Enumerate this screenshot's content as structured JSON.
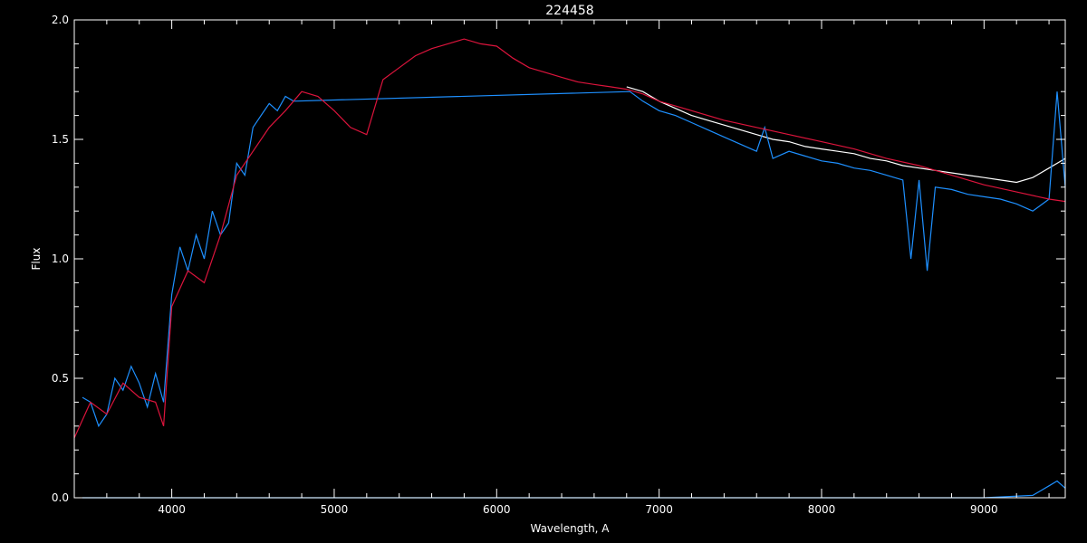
{
  "chart_data": {
    "type": "line",
    "title": "224458",
    "xlabel": "Wavelength, A",
    "ylabel": "Flux",
    "xlim": [
      3400,
      9500
    ],
    "ylim": [
      0.0,
      2.0
    ],
    "x_ticks": [
      4000,
      5000,
      6000,
      7000,
      8000,
      9000
    ],
    "x_tick_labels": [
      "4000",
      "5000",
      "6000",
      "7000",
      "8000",
      "9000"
    ],
    "y_ticks": [
      0.0,
      0.5,
      1.0,
      1.5,
      2.0
    ],
    "y_tick_labels": [
      "0.0",
      "0.5",
      "1.0",
      "1.5",
      "2.0"
    ],
    "background": "#000000",
    "grid": false,
    "series": [
      {
        "color": "#ffffff",
        "x": [
          6800,
          6900,
          7000,
          7100,
          7200,
          7300,
          7400,
          7500,
          7600,
          7700,
          7800,
          7900,
          8000,
          8100,
          8200,
          8300,
          8400,
          8500,
          8600,
          8700,
          8800,
          8900,
          9000,
          9100,
          9200,
          9300,
          9400,
          9500
        ],
        "y": [
          1.72,
          1.7,
          1.66,
          1.63,
          1.6,
          1.58,
          1.56,
          1.54,
          1.52,
          1.5,
          1.49,
          1.47,
          1.46,
          1.45,
          1.44,
          1.42,
          1.41,
          1.39,
          1.38,
          1.37,
          1.36,
          1.35,
          1.34,
          1.33,
          1.32,
          1.34,
          1.38,
          1.42
        ]
      },
      {
        "color": "#1e90ff",
        "x": [
          3450,
          3500,
          3550,
          3600,
          3650,
          3700,
          3750,
          3800,
          3850,
          3900,
          3950,
          4000,
          4050,
          4100,
          4150,
          4200,
          4250,
          4300,
          4350,
          4400,
          4450,
          4500,
          4550,
          4600,
          4650,
          4700,
          4750,
          6820,
          6900,
          7000,
          7100,
          7200,
          7300,
          7400,
          7500,
          7600,
          7650,
          7700,
          7800,
          7900,
          8000,
          8100,
          8200,
          8300,
          8400,
          8500,
          8550,
          8600,
          8650,
          8700,
          8800,
          8900,
          9000,
          9100,
          9200,
          9300,
          9400,
          9450,
          9500
        ],
        "y": [
          0.42,
          0.4,
          0.3,
          0.35,
          0.5,
          0.45,
          0.55,
          0.48,
          0.38,
          0.52,
          0.4,
          0.85,
          1.05,
          0.95,
          1.1,
          1.0,
          1.2,
          1.1,
          1.15,
          1.4,
          1.35,
          1.55,
          1.6,
          1.65,
          1.62,
          1.68,
          1.66,
          1.7,
          1.66,
          1.62,
          1.6,
          1.57,
          1.54,
          1.51,
          1.48,
          1.45,
          1.55,
          1.42,
          1.45,
          1.43,
          1.41,
          1.4,
          1.38,
          1.37,
          1.35,
          1.33,
          1.0,
          1.33,
          0.95,
          1.3,
          1.29,
          1.27,
          1.26,
          1.25,
          1.23,
          1.2,
          1.25,
          1.7,
          1.3
        ]
      },
      {
        "color": "#1e90ff",
        "x": [
          3450,
          4000,
          5000,
          6000,
          7000,
          8000,
          9000,
          9300,
          9350,
          9400,
          9450,
          9500
        ],
        "y": [
          0.0,
          0.0,
          0.0,
          0.0,
          0.0,
          0.0,
          0.0,
          0.01,
          0.03,
          0.05,
          0.07,
          0.04
        ]
      },
      {
        "color": "#dc143c",
        "x": [
          3400,
          3500,
          3600,
          3700,
          3800,
          3900,
          3950,
          4000,
          4100,
          4200,
          4300,
          4400,
          4500,
          4600,
          4700,
          4800,
          4900,
          5000,
          5100,
          5200,
          5300,
          5400,
          5500,
          5600,
          5700,
          5800,
          5900,
          6000,
          6100,
          6200,
          6300,
          6400,
          6500,
          6600,
          6700,
          6800,
          6900,
          7000,
          7200,
          7400,
          7600,
          7800,
          8000,
          8200,
          8400,
          8600,
          8800,
          9000,
          9200,
          9400,
          9500
        ],
        "y": [
          0.25,
          0.4,
          0.35,
          0.48,
          0.42,
          0.4,
          0.3,
          0.8,
          0.95,
          0.9,
          1.1,
          1.35,
          1.45,
          1.55,
          1.62,
          1.7,
          1.68,
          1.62,
          1.55,
          1.52,
          1.75,
          1.8,
          1.85,
          1.88,
          1.9,
          1.92,
          1.9,
          1.89,
          1.84,
          1.8,
          1.78,
          1.76,
          1.74,
          1.73,
          1.72,
          1.71,
          1.69,
          1.66,
          1.62,
          1.58,
          1.55,
          1.52,
          1.49,
          1.46,
          1.42,
          1.39,
          1.35,
          1.31,
          1.28,
          1.25,
          1.24
        ]
      }
    ]
  }
}
